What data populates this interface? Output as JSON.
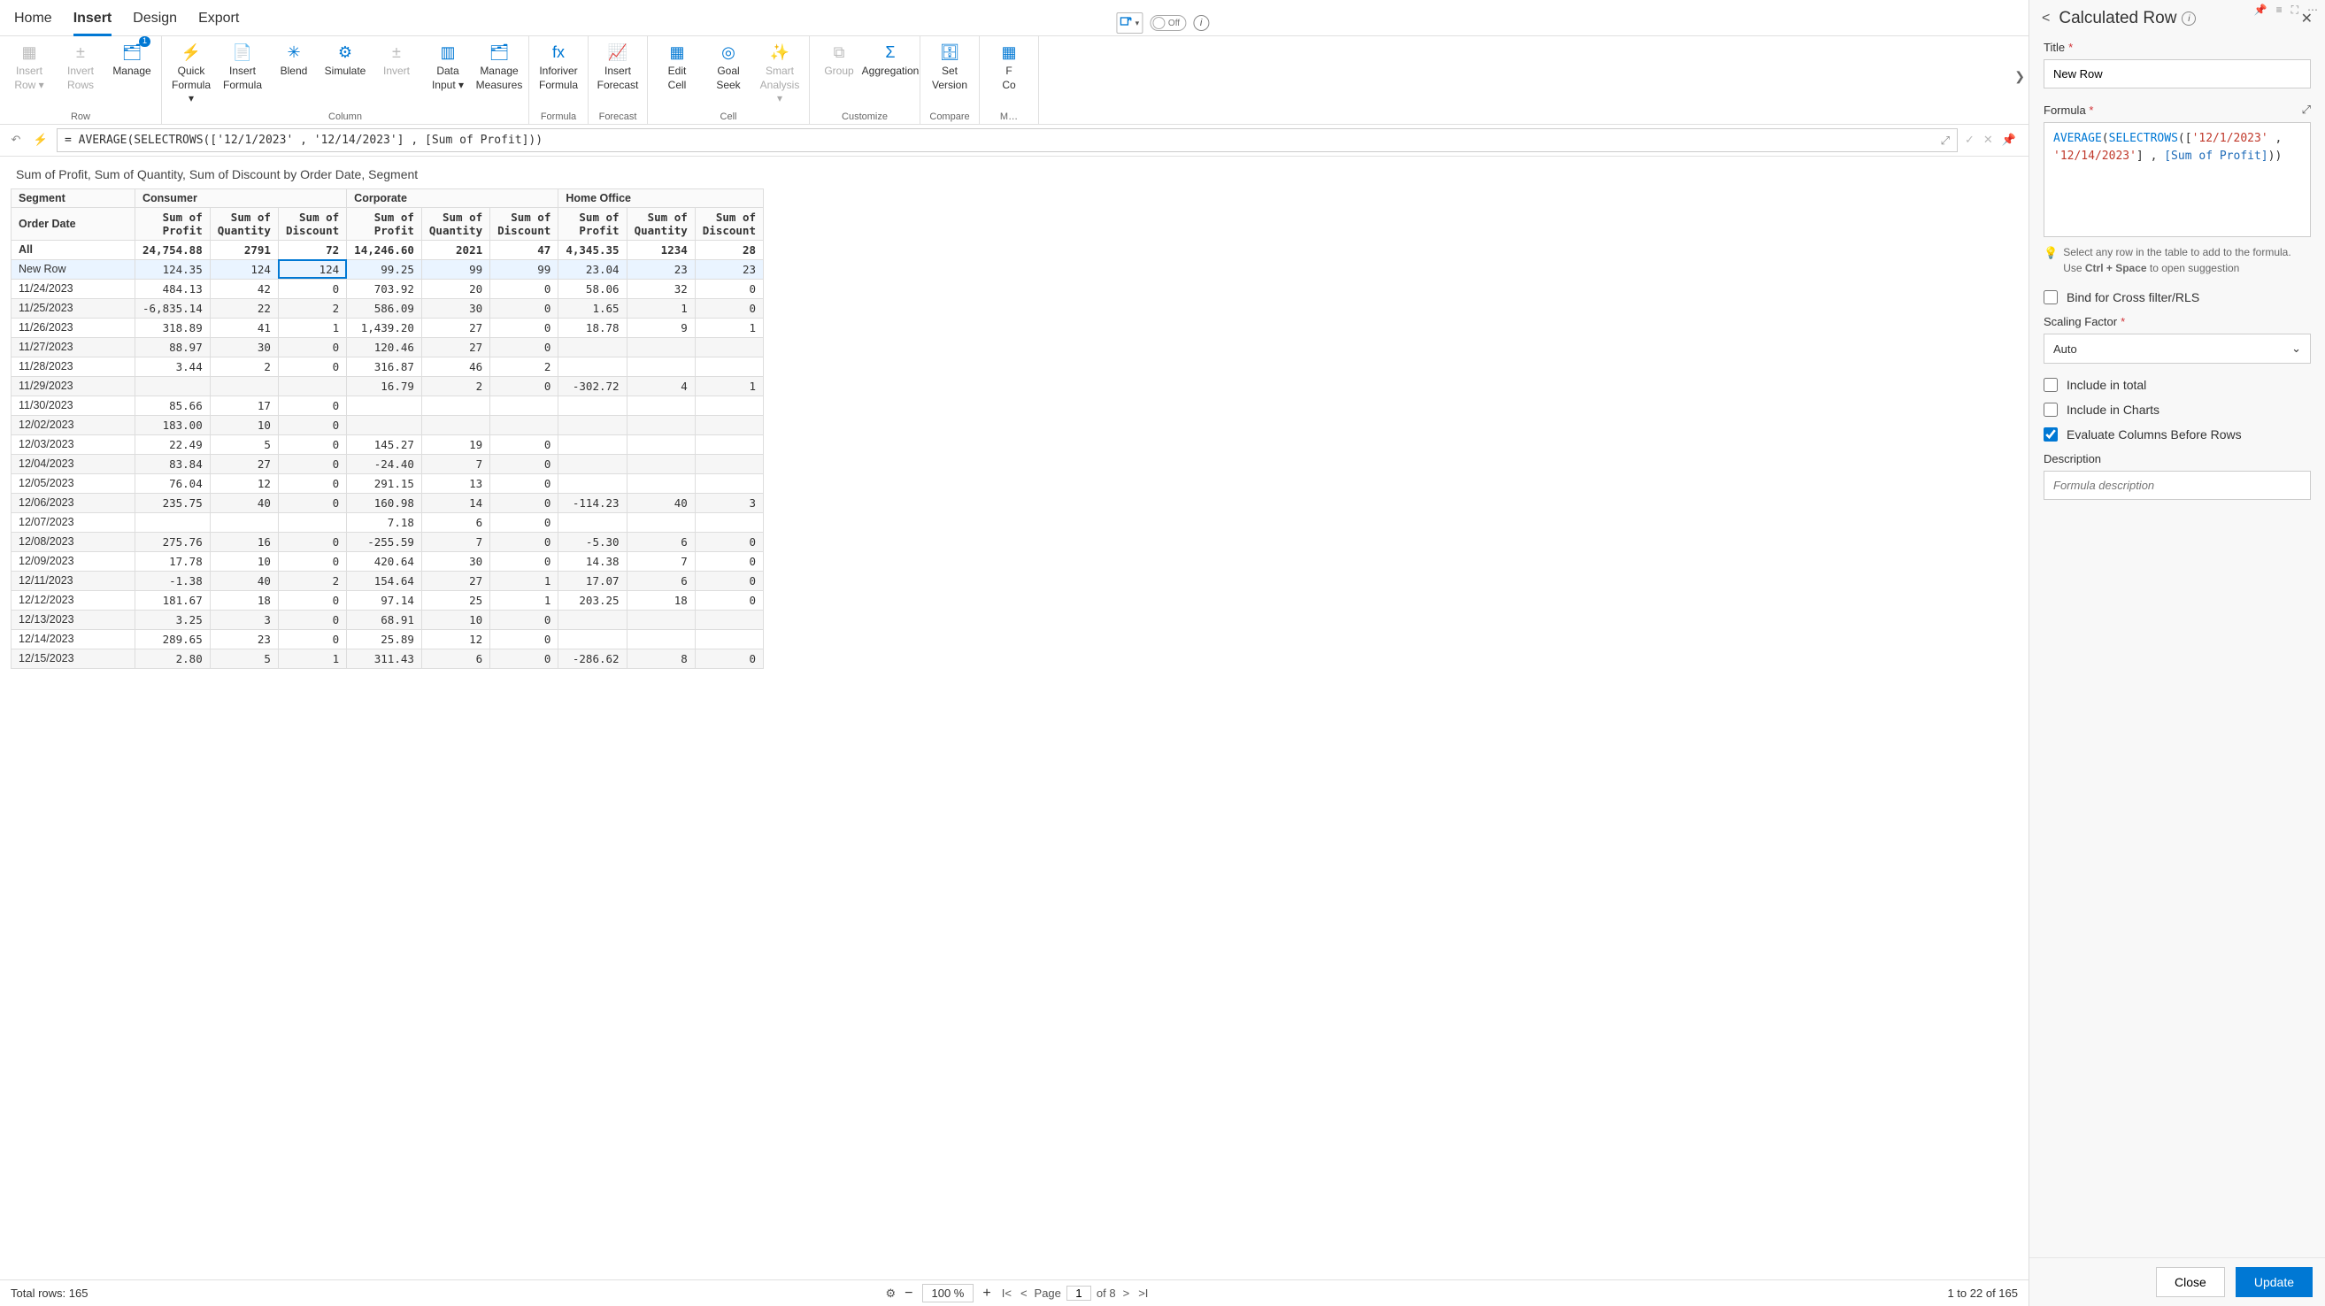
{
  "tabs": [
    "Home",
    "Insert",
    "Design",
    "Export"
  ],
  "active_tab": "Insert",
  "mini_toggle": {
    "label": "Off"
  },
  "ribbon": {
    "groups": [
      {
        "label": "Row",
        "buttons": [
          {
            "id": "insert-row",
            "line1": "Insert",
            "line2": "Row ▾",
            "disabled": true
          },
          {
            "id": "invert-rows",
            "line1": "Invert",
            "line2": "Rows",
            "disabled": true
          },
          {
            "id": "manage-rows",
            "line1": "Manage",
            "line2": "",
            "badge": "1"
          }
        ]
      },
      {
        "label": "Column",
        "buttons": [
          {
            "id": "quick-formula",
            "line1": "Quick",
            "line2": "Formula ▾"
          },
          {
            "id": "insert-formula",
            "line1": "Insert",
            "line2": "Formula"
          },
          {
            "id": "blend",
            "line1": "Blend",
            "line2": ""
          },
          {
            "id": "simulate",
            "line1": "Simulate",
            "line2": ""
          },
          {
            "id": "invert-col",
            "line1": "Invert",
            "line2": "",
            "disabled": true
          },
          {
            "id": "data-input",
            "line1": "Data",
            "line2": "Input ▾"
          },
          {
            "id": "manage-measures",
            "line1": "Manage",
            "line2": "Measures"
          }
        ]
      },
      {
        "label": "Formula",
        "buttons": [
          {
            "id": "inforiver-formula",
            "line1": "Inforiver",
            "line2": "Formula"
          }
        ]
      },
      {
        "label": "Forecast",
        "buttons": [
          {
            "id": "insert-forecast",
            "line1": "Insert",
            "line2": "Forecast"
          }
        ]
      },
      {
        "label": "Cell",
        "buttons": [
          {
            "id": "edit-cell",
            "line1": "Edit",
            "line2": "Cell"
          },
          {
            "id": "goal-seek",
            "line1": "Goal",
            "line2": "Seek"
          },
          {
            "id": "smart-analysis",
            "line1": "Smart",
            "line2": "Analysis ▾",
            "disabled": true
          }
        ]
      },
      {
        "label": "Customize",
        "buttons": [
          {
            "id": "group",
            "line1": "Group",
            "line2": "",
            "disabled": true
          },
          {
            "id": "aggregation",
            "line1": "Aggregation",
            "line2": ""
          }
        ]
      },
      {
        "label": "Compare",
        "buttons": [
          {
            "id": "set-version",
            "line1": "Set",
            "line2": "Version"
          }
        ]
      },
      {
        "label": "M…",
        "buttons": [
          {
            "id": "more-co",
            "line1": "F",
            "line2": "Co"
          }
        ]
      }
    ]
  },
  "formula_bar": {
    "prefix": "=",
    "text": "AVERAGE(SELECTROWS(['12/1/2023' , '12/14/2023'] , [Sum of Profit]))"
  },
  "subtitle": "Sum of Profit, Sum of Quantity, Sum of Discount by Order Date, Segment",
  "table": {
    "row_header": "Segment",
    "order_header": "Order Date",
    "segments": [
      "Consumer",
      "Corporate",
      "Home Office"
    ],
    "measures": [
      "Sum of Profit",
      "Sum of Quantity",
      "Sum of Discount"
    ],
    "all_label": "All",
    "all_row": [
      "24,754.88",
      "2791",
      "72",
      "14,246.60",
      "2021",
      "47",
      "4,345.35",
      "1234",
      "28"
    ],
    "new_row_label": "New Row",
    "new_row": [
      "124.35",
      "124",
      "124",
      "99.25",
      "99",
      "99",
      "23.04",
      "23",
      "23"
    ],
    "rows": [
      {
        "d": "11/24/2023",
        "v": [
          "484.13",
          "42",
          "0",
          "703.92",
          "20",
          "0",
          "58.06",
          "32",
          "0"
        ]
      },
      {
        "d": "11/25/2023",
        "v": [
          "-6,835.14",
          "22",
          "2",
          "586.09",
          "30",
          "0",
          "1.65",
          "1",
          "0"
        ]
      },
      {
        "d": "11/26/2023",
        "v": [
          "318.89",
          "41",
          "1",
          "1,439.20",
          "27",
          "0",
          "18.78",
          "9",
          "1"
        ]
      },
      {
        "d": "11/27/2023",
        "v": [
          "88.97",
          "30",
          "0",
          "120.46",
          "27",
          "0",
          "",
          "",
          ""
        ]
      },
      {
        "d": "11/28/2023",
        "v": [
          "3.44",
          "2",
          "0",
          "316.87",
          "46",
          "2",
          "",
          "",
          ""
        ]
      },
      {
        "d": "11/29/2023",
        "v": [
          "",
          "",
          "",
          "16.79",
          "2",
          "0",
          "-302.72",
          "4",
          "1"
        ]
      },
      {
        "d": "11/30/2023",
        "v": [
          "85.66",
          "17",
          "0",
          "",
          "",
          "",
          "",
          "",
          ""
        ]
      },
      {
        "d": "12/02/2023",
        "v": [
          "183.00",
          "10",
          "0",
          "",
          "",
          "",
          "",
          "",
          ""
        ]
      },
      {
        "d": "12/03/2023",
        "v": [
          "22.49",
          "5",
          "0",
          "145.27",
          "19",
          "0",
          "",
          "",
          ""
        ]
      },
      {
        "d": "12/04/2023",
        "v": [
          "83.84",
          "27",
          "0",
          "-24.40",
          "7",
          "0",
          "",
          "",
          ""
        ]
      },
      {
        "d": "12/05/2023",
        "v": [
          "76.04",
          "12",
          "0",
          "291.15",
          "13",
          "0",
          "",
          "",
          ""
        ]
      },
      {
        "d": "12/06/2023",
        "v": [
          "235.75",
          "40",
          "0",
          "160.98",
          "14",
          "0",
          "-114.23",
          "40",
          "3"
        ]
      },
      {
        "d": "12/07/2023",
        "v": [
          "",
          "",
          "",
          "7.18",
          "6",
          "0",
          "",
          "",
          ""
        ]
      },
      {
        "d": "12/08/2023",
        "v": [
          "275.76",
          "16",
          "0",
          "-255.59",
          "7",
          "0",
          "-5.30",
          "6",
          "0"
        ]
      },
      {
        "d": "12/09/2023",
        "v": [
          "17.78",
          "10",
          "0",
          "420.64",
          "30",
          "0",
          "14.38",
          "7",
          "0"
        ]
      },
      {
        "d": "12/11/2023",
        "v": [
          "-1.38",
          "40",
          "2",
          "154.64",
          "27",
          "1",
          "17.07",
          "6",
          "0"
        ]
      },
      {
        "d": "12/12/2023",
        "v": [
          "181.67",
          "18",
          "0",
          "97.14",
          "25",
          "1",
          "203.25",
          "18",
          "0"
        ]
      },
      {
        "d": "12/13/2023",
        "v": [
          "3.25",
          "3",
          "0",
          "68.91",
          "10",
          "0",
          "",
          "",
          ""
        ]
      },
      {
        "d": "12/14/2023",
        "v": [
          "289.65",
          "23",
          "0",
          "25.89",
          "12",
          "0",
          "",
          "",
          ""
        ]
      },
      {
        "d": "12/15/2023",
        "v": [
          "2.80",
          "5",
          "1",
          "311.43",
          "6",
          "0",
          "-286.62",
          "8",
          "0"
        ]
      }
    ]
  },
  "status": {
    "total_rows_label": "Total rows: 165",
    "zoom": "100 %",
    "page_label": "Page",
    "page_current": "1",
    "page_total": "of 8",
    "range": "1 to 22 of 165"
  },
  "panel": {
    "title": "Calculated Row",
    "fields": {
      "title_label": "Title",
      "title_value": "New Row",
      "formula_label": "Formula",
      "formula_tokens": {
        "fn1": "AVERAGE",
        "fn2": "SELECTROWS",
        "str1": "'12/1/2023'",
        "str2": "'12/14/2023'",
        "field": "[Sum of Profit]"
      },
      "hint_line1": "Select any row in the table to add to the formula.",
      "hint_line2_prefix": "Use ",
      "hint_ctrl": "Ctrl + Space",
      "hint_line2_suffix": " to open suggestion",
      "bind_label": "Bind for Cross filter/RLS",
      "scaling_label": "Scaling Factor",
      "scaling_value": "Auto",
      "include_total": "Include in total",
      "include_charts": "Include in Charts",
      "eval_cols": "Evaluate Columns Before Rows",
      "description_label": "Description",
      "description_placeholder": "Formula description"
    },
    "footer": {
      "close": "Close",
      "update": "Update"
    }
  }
}
